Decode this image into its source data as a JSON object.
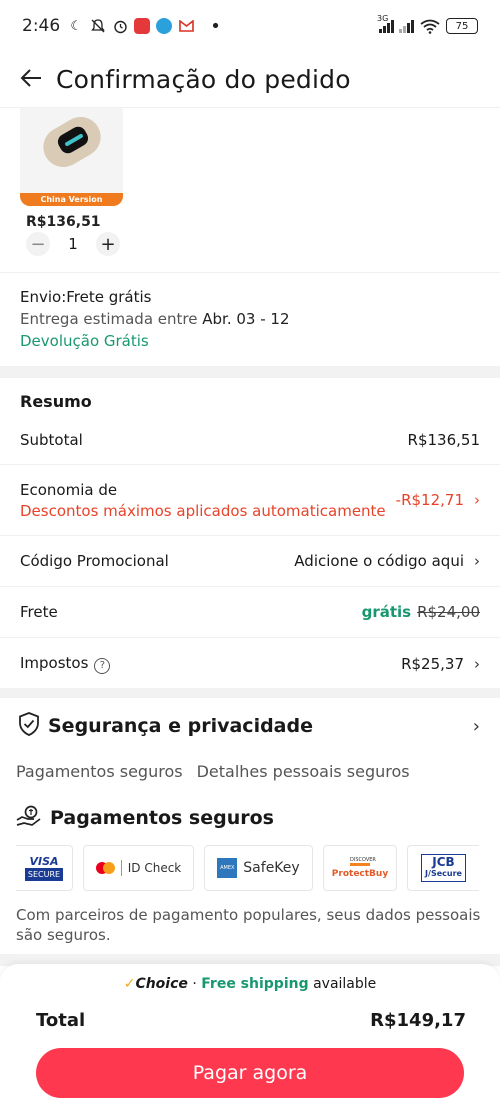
{
  "status_bar": {
    "time": "2:46",
    "network_label": "3G",
    "battery": "75"
  },
  "header": {
    "title": "Confirmação do pedido"
  },
  "product": {
    "version_tag": "China Version",
    "price": "R$136,51",
    "quantity": "1"
  },
  "shipping": {
    "title": "Envio:Frete grátis",
    "eta_label": "Entrega estimada entre",
    "eta_date": "Abr. 03 - 12",
    "return": "Devolução Grátis"
  },
  "summary": {
    "title": "Resumo",
    "subtotal_label": "Subtotal",
    "subtotal_value": "R$136,51",
    "savings_label": "Economia de",
    "savings_desc": "Descontos máximos aplicados automaticamente",
    "savings_value": "-R$12,71",
    "promo_label": "Código Promocional",
    "promo_value": "Adicione o código aqui",
    "freight_label": "Frete",
    "freight_free": "grátis",
    "freight_original": "R$24,00",
    "taxes_label": "Impostos",
    "taxes_value": "R$25,37"
  },
  "security": {
    "title": "Segurança e privacidade",
    "tab1": "Pagamentos seguros",
    "tab2": "Detalhes pessoais seguros",
    "payments_title": "Pagamentos seguros",
    "cards": {
      "visa": "VISA",
      "visa_sub": "SECURE",
      "mastercard": "ID Check",
      "amex": "SafeKey",
      "discover_top": "DISCOVER",
      "discover": "ProtectBuy",
      "jcb": "JCB",
      "jcb_sub": "J/Secure"
    },
    "note": "Com parceiros de pagamento populares, seus dados pessoais são seguros."
  },
  "bottom": {
    "choice": "Choice",
    "dot": "·",
    "free_shipping": "Free shipping",
    "available": "available",
    "total_label": "Total",
    "total_value": "R$149,17",
    "pay_button": "Pagar agora"
  },
  "colors": {
    "accent_red": "#fd384f",
    "discount_red": "#e8432a",
    "green": "#189870",
    "tag_orange": "#f07a1e"
  }
}
